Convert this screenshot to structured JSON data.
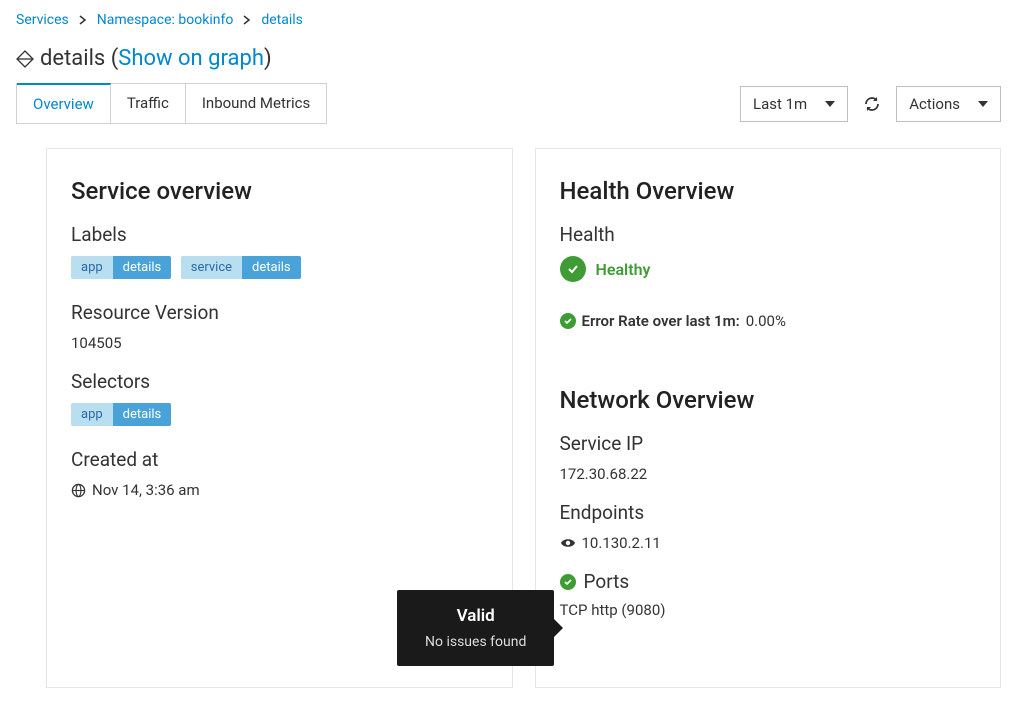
{
  "breadcrumb": {
    "services": "Services",
    "namespace": "Namespace: bookinfo",
    "current": "details"
  },
  "title": {
    "name": "details",
    "show_on_graph": "Show on graph"
  },
  "tabs": {
    "overview": "Overview",
    "traffic": "Traffic",
    "inbound": "Inbound Metrics"
  },
  "controls": {
    "time_label": "Last 1m",
    "actions_label": "Actions"
  },
  "service_overview": {
    "heading": "Service overview",
    "labels_heading": "Labels",
    "labels": [
      {
        "k": "app",
        "v": "details"
      },
      {
        "k": "service",
        "v": "details"
      }
    ],
    "resource_version_heading": "Resource Version",
    "resource_version": "104505",
    "selectors_heading": "Selectors",
    "selectors": [
      {
        "k": "app",
        "v": "details"
      }
    ],
    "created_heading": "Created at",
    "created_value": "Nov 14, 3:36 am"
  },
  "health": {
    "heading": "Health Overview",
    "subheading": "Health",
    "status_text": "Healthy",
    "error_rate_label": "Error Rate over last 1m:",
    "error_rate_value": "0.00%"
  },
  "network": {
    "heading": "Network Overview",
    "service_ip_heading": "Service IP",
    "service_ip": "172.30.68.22",
    "endpoints_heading": "Endpoints",
    "endpoint_value": "10.130.2.11",
    "ports_heading": "Ports",
    "port_value": "TCP http (9080)"
  },
  "tooltip": {
    "title": "Valid",
    "body": "No issues found"
  }
}
